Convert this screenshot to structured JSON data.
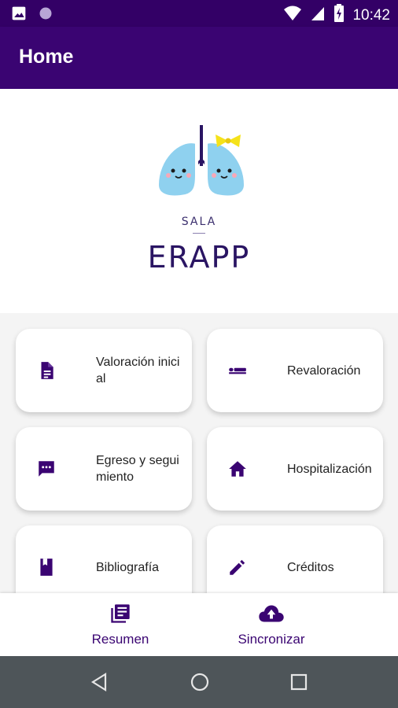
{
  "status_bar": {
    "time": "10:42",
    "icons": [
      "image-icon",
      "circle-icon",
      "wifi-icon",
      "signal-icon",
      "battery-charging-icon"
    ]
  },
  "app_bar": {
    "title": "Home"
  },
  "hero": {
    "subtitle": "SALA",
    "brand": "ERAPP"
  },
  "cards": [
    {
      "label": "Valoración inicial",
      "icon": "document-icon"
    },
    {
      "label": "Revaloración",
      "icon": "bed-icon"
    },
    {
      "label": "Egreso y seguimiento",
      "icon": "chat-icon"
    },
    {
      "label": "Hospitalización",
      "icon": "home-icon"
    },
    {
      "label": "Bibliografía",
      "icon": "book-icon"
    },
    {
      "label": "Créditos",
      "icon": "edit-icon"
    }
  ],
  "bottom_nav": [
    {
      "label": "Resumen",
      "icon": "library-books-icon"
    },
    {
      "label": "Sincronizar",
      "icon": "cloud-upload-icon"
    }
  ],
  "colors": {
    "primary": "#3a0472",
    "status_bar": "#330066",
    "system_nav": "#4e5559",
    "background": "#f4f4f4"
  }
}
